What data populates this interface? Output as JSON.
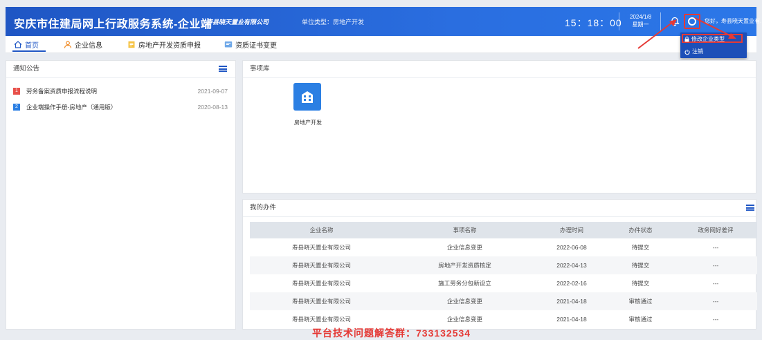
{
  "header": {
    "title": "安庆市住建局网上行政服务系统-企业端",
    "company": "寿县晓天置业有限公司",
    "unit_type": "单位类型：房地产开发",
    "time": "15：18：00",
    "date": "2024/1/8",
    "weekday": "星期一",
    "greeting": "您好，寿县晓天置业有..."
  },
  "nav": {
    "items": [
      {
        "label": "首页"
      },
      {
        "label": "企业信息"
      },
      {
        "label": "房地产开发资质申报"
      },
      {
        "label": "资质证书变更"
      }
    ]
  },
  "dropdown": {
    "items": [
      {
        "label": "修改企业类型"
      },
      {
        "label": "注销"
      }
    ]
  },
  "notice": {
    "title": "通知公告",
    "items": [
      {
        "num": "1",
        "text": "劳务备案资质申报流程说明",
        "date": "2021-09-07",
        "color": "#e8504a"
      },
      {
        "num": "2",
        "text": "企业端操作手册-房地产（通用版）",
        "date": "2020-08-13",
        "color": "#2b7fe3"
      }
    ]
  },
  "matters": {
    "title": "事项库",
    "items": [
      {
        "label": "房地产开发"
      }
    ]
  },
  "tasks": {
    "title": "我的办件",
    "headers": [
      "企业名称",
      "事项名称",
      "办理时间",
      "办件状态",
      "政务网好差评"
    ],
    "rows": [
      [
        "寿县晓天置业有限公司",
        "企业信息变更",
        "2022-06-08",
        "待提交",
        "---"
      ],
      [
        "寿县晓天置业有限公司",
        "房地产开发资质核定",
        "2022-04-13",
        "待提交",
        "---"
      ],
      [
        "寿县晓天置业有限公司",
        "施工劳务分包新设立",
        "2022-02-16",
        "待提交",
        "---"
      ],
      [
        "寿县晓天置业有限公司",
        "企业信息变更",
        "2021-04-18",
        "审核通过",
        "---"
      ],
      [
        "寿县晓天置业有限公司",
        "企业信息变更",
        "2021-04-18",
        "审核通过",
        "---"
      ]
    ]
  },
  "footer": {
    "notice": "平台技术问题解答群：733132534"
  }
}
